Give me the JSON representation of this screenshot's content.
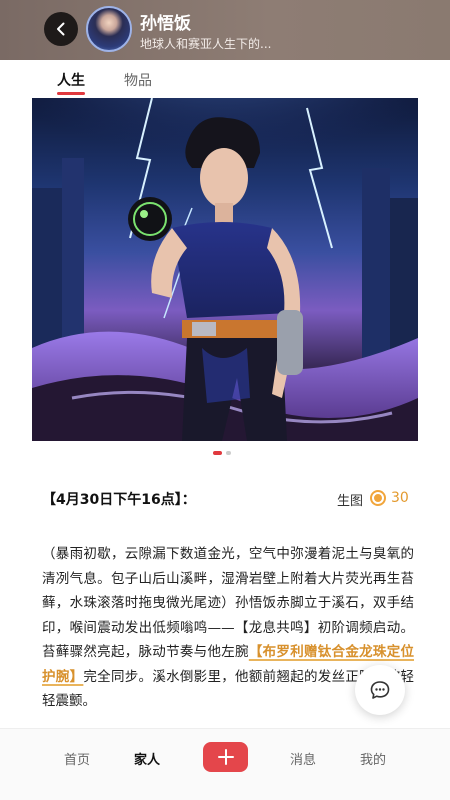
{
  "header": {
    "name": "孙悟饭",
    "subtitle": "地球人和赛亚人生下的..."
  },
  "tabs": [
    {
      "label": "人生",
      "active": true
    },
    {
      "label": "物品",
      "active": false
    }
  ],
  "carousel": {
    "current_page": 1,
    "total_pages": 2
  },
  "entry": {
    "time_heading": "【4月30日下午16点】：",
    "generate_label": "生图",
    "coin_value": "30",
    "story_part1": "（暴雨初歇，云隙漏下数道金光，空气中弥漫着泥土与臭氧的清冽气息。包子山后山溪畔，湿滑岩壁上附着大片荧光再生苔藓，水珠滚落时拖曳微光尾迹）孙悟饭赤脚立于溪石，双手结印，喉间震动发出低频嗡鸣——【龙息共鸣】初阶调频启动。苔藓骤然亮起，脉动节奏与他左腕",
    "story_highlight": "【布罗利赠钛合金龙珠定位护腕】",
    "story_part2": "完全同步。溪水倒影里，他额前翘起的发丝正随声波轻轻震颤。"
  },
  "bottom_nav": {
    "home": "首页",
    "family": "家人",
    "messages": "消息",
    "mine": "我的"
  },
  "colors": {
    "accent": "#e0393e",
    "highlight": "#d8912d",
    "coin": "#f1a53b"
  }
}
